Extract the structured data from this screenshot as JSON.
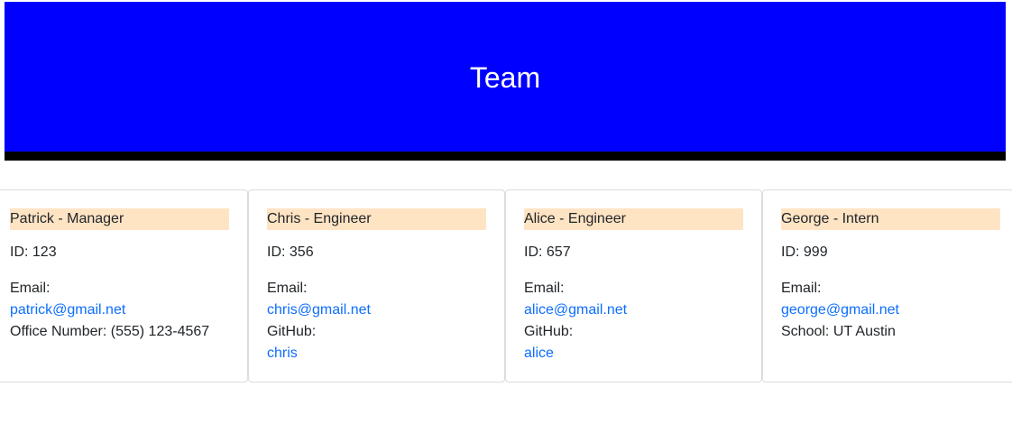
{
  "header": {
    "title": "Team",
    "background": "#0000ff",
    "border_color": "#000000"
  },
  "colors": {
    "card_title_bg": "#ffe4c4",
    "link": "#0d6efd"
  },
  "cards": [
    {
      "title": "Patrick - Manager",
      "id_label": "ID: 123",
      "email_label": "Email:",
      "email": "patrick@gmail.net",
      "extra": "Office Number: (555) 123-4567"
    },
    {
      "title": "Chris - Engineer",
      "id_label": "ID: 356",
      "email_label": "Email:",
      "email": "chris@gmail.net",
      "github_label": "GitHub:",
      "github": "chris"
    },
    {
      "title": "Alice - Engineer",
      "id_label": "ID: 657",
      "email_label": "Email:",
      "email": "alice@gmail.net",
      "github_label": "GitHub:",
      "github": "alice"
    },
    {
      "title": "George - Intern",
      "id_label": "ID: 999",
      "email_label": "Email:",
      "email": "george@gmail.net",
      "extra": "School: UT Austin"
    }
  ]
}
